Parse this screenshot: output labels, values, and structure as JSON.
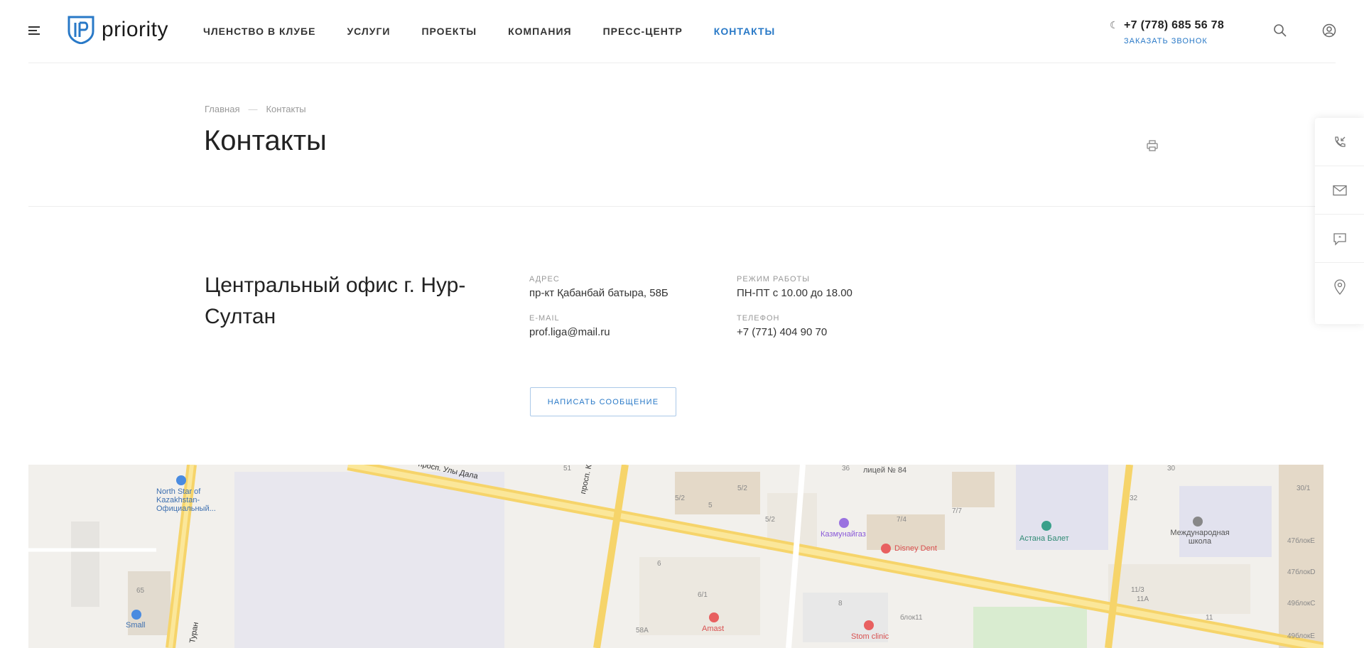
{
  "header": {
    "logo_text": "priority",
    "nav": [
      {
        "label": "ЧЛЕНСТВО В КЛУБЕ",
        "active": false
      },
      {
        "label": "УСЛУГИ",
        "active": false
      },
      {
        "label": "ПРОЕКТЫ",
        "active": false
      },
      {
        "label": "КОМПАНИЯ",
        "active": false
      },
      {
        "label": "ПРЕСС-ЦЕНТР",
        "active": false
      },
      {
        "label": "КОНТАКТЫ",
        "active": true
      }
    ],
    "phone": "+7 (778) 685 56 78",
    "callback": "ЗАКАЗАТЬ ЗВОНОК",
    "accent_color": "#2979c7"
  },
  "breadcrumb": {
    "home": "Главная",
    "separator": "—",
    "current": "Контакты"
  },
  "page": {
    "title": "Контакты"
  },
  "office": {
    "title": "Центральный офис г. Нур-Султан",
    "address_label": "АДРЕС",
    "address": "пр-кт Қабанбай батыра, 58Б",
    "hours_label": "РЕЖИМ РАБОТЫ",
    "hours": "ПН-ПТ с 10.00 до 18.00",
    "email_label": "E-MAIL",
    "email": "prof.liga@mail.ru",
    "phone_label": "ТЕЛЕФОН",
    "phone": "+7 (771) 404 90 70",
    "message_button": "НАПИСАТЬ СООБЩЕНИЕ"
  },
  "side_bar": [
    {
      "icon": "phone-callback-icon"
    },
    {
      "icon": "mail-icon"
    },
    {
      "icon": "chat-icon"
    },
    {
      "icon": "location-pin-icon"
    }
  ],
  "map": {
    "labels": {
      "north_star": "North Star of Kazakhstan- Официальный...",
      "street_uly_dala": "просп. Улы Дала",
      "street_kabanbay": "просп. Кабанбай Батыра",
      "street_turan": "Туран",
      "small": "Small",
      "licey": "лицей № 84",
      "kazmunaygaz": "Казмунайгаз",
      "disney_dent": "Disney Dent",
      "astana_ballet": "Астана Балет",
      "school": "Международная школа",
      "amast": "Amast",
      "stom_clinic": "Stom clinic",
      "n65": "65",
      "n51": "51",
      "n5_2a": "5/2",
      "n5": "5",
      "n5_2b": "5/2",
      "n5_2c": "5/2",
      "n36": "36",
      "n7_4": "7/4",
      "n7_7": "7/7",
      "n6": "6",
      "n6_1": "6/1",
      "n8": "8",
      "n58a": "58А",
      "n30": "30",
      "n32": "32",
      "n30_1": "30/1",
      "n47e": "47блокЕ",
      "n47d": "47блокD",
      "n49c": "49блокС",
      "n49e": "49блокЕ",
      "n11_3": "11/3",
      "n11a": "11А",
      "n11": "11",
      "n6_11": "блок11"
    }
  }
}
